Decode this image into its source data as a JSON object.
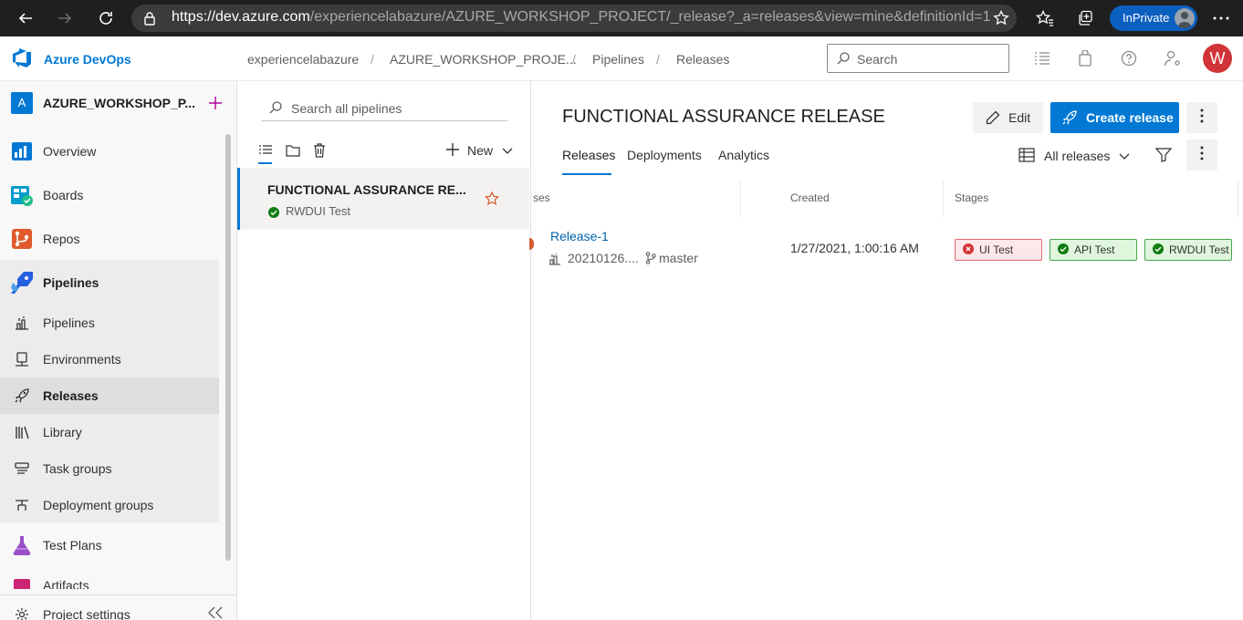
{
  "browser": {
    "url_host": "https://dev.azure.com",
    "url_path": "/experiencelabazure/AZURE_WORKSHOP_PROJECT/_release?_a=releases&view=mine&definitionId=1",
    "inprivate_label": "InPrivate"
  },
  "header": {
    "brand": "Azure DevOps",
    "breadcrumbs": [
      "experiencelabazure",
      "AZURE_WORKSHOP_PROJE...",
      "Pipelines",
      "Releases"
    ],
    "search_placeholder": "Search",
    "user_initial": "W"
  },
  "sidebar": {
    "project_initial": "A",
    "project_name": "AZURE_WORKSHOP_P...",
    "items": [
      {
        "label": "Overview",
        "icon": "overview-icon"
      },
      {
        "label": "Boards",
        "icon": "boards-icon"
      },
      {
        "label": "Repos",
        "icon": "repos-icon"
      },
      {
        "label": "Pipelines",
        "icon": "pipelines-icon"
      },
      {
        "label": "Pipelines",
        "icon": "pipeline-sub-icon"
      },
      {
        "label": "Environments",
        "icon": "environments-icon"
      },
      {
        "label": "Releases",
        "icon": "releases-icon"
      },
      {
        "label": "Library",
        "icon": "library-icon"
      },
      {
        "label": "Task groups",
        "icon": "task-groups-icon"
      },
      {
        "label": "Deployment groups",
        "icon": "deployment-groups-icon"
      },
      {
        "label": "Test Plans",
        "icon": "test-plans-icon"
      },
      {
        "label": "Artifacts",
        "icon": "artifacts-icon"
      }
    ],
    "project_settings": "Project settings"
  },
  "definitions_pane": {
    "search_placeholder": "Search all pipelines",
    "new_label": "New",
    "definitions": [
      {
        "title": "FUNCTIONAL ASSURANCE RE...",
        "subtitle": "RWDUI Test"
      }
    ]
  },
  "main": {
    "title": "FUNCTIONAL ASSURANCE RELEASE",
    "edit_label": "Edit",
    "create_release_label": "Create release",
    "tabs": [
      "Releases",
      "Deployments",
      "Analytics"
    ],
    "active_tab": "Releases",
    "view_filter_label": "All releases",
    "columns": [
      "ses",
      "Created",
      "Stages"
    ],
    "releases": [
      {
        "name": "Release-1",
        "build": "20210126....",
        "branch": "master",
        "created": "1/27/2021, 1:00:16 AM",
        "stages": [
          {
            "name": "UI Test",
            "status": "failed"
          },
          {
            "name": "API Test",
            "status": "succeeded"
          },
          {
            "name": "RWDUI Test",
            "status": "succeeded"
          }
        ]
      }
    ]
  },
  "colors": {
    "accent": "#0078d4",
    "failed": "#d13438",
    "succeeded": "#107c10",
    "browser_chrome": "#1f1f1f"
  }
}
